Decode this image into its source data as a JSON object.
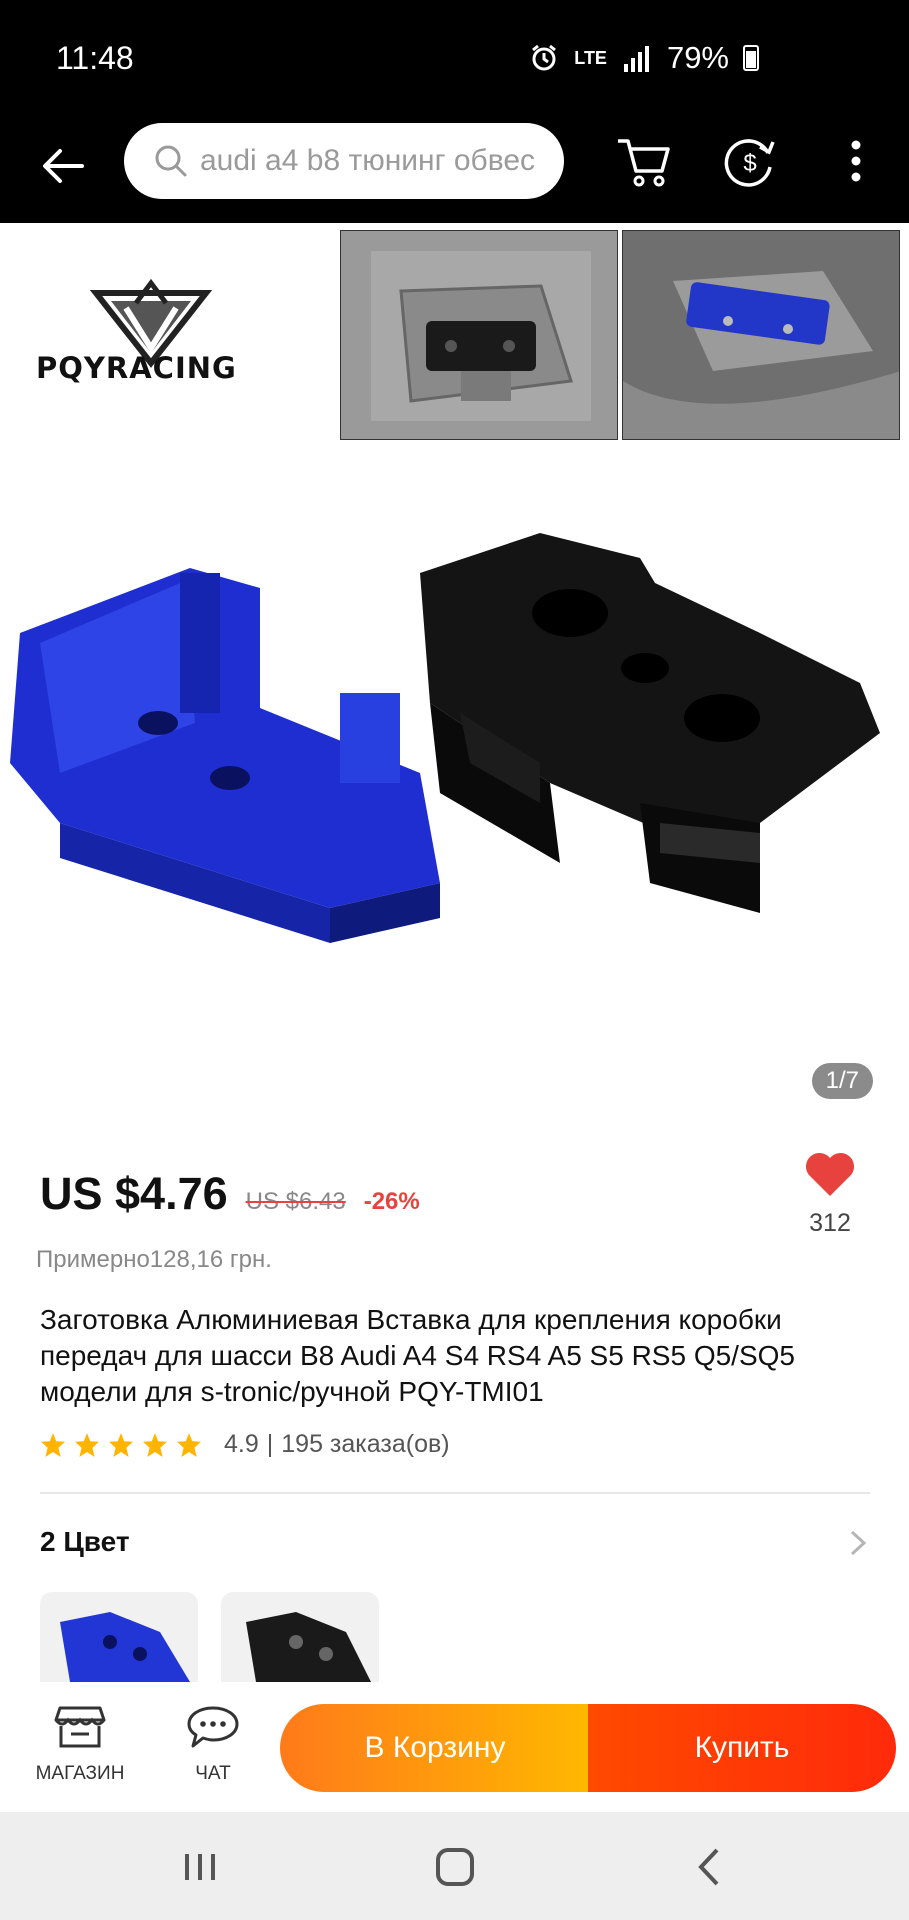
{
  "status_bar": {
    "time": "11:48",
    "network": "LTE",
    "battery": "79%"
  },
  "search": {
    "placeholder": "audi a4 b8 тюнинг обвес"
  },
  "gallery": {
    "brand_name": "PQYRACING",
    "counter": "1/7"
  },
  "product": {
    "price": "US $4.76",
    "old_price": "US $6.43",
    "discount": "-26%",
    "wishlist_count": "312",
    "approx_price": "Примерно128,16 грн.",
    "title": "Заготовка Алюминиевая Вставка для крепления коробки передач для шасси B8 Audi A4 S4 RS4 A5 S5 RS5 Q5/SQ5 модели для s-tronic/ручной PQY-TMI01",
    "rating": "4.9",
    "orders": "195 заказа(ов)",
    "stars": 5
  },
  "colors": {
    "title": "2 Цвет",
    "options": [
      "blue",
      "black"
    ]
  },
  "action_bar": {
    "store_label": "МАГАЗИН",
    "chat_label": "ЧАТ",
    "cart_label": "В Корзину",
    "buy_label": "Купить"
  },
  "theme": {
    "accent_red": "#e8423e",
    "star_color": "#ffb400",
    "cart_gradient": [
      "#ff7a1a",
      "#ffb800"
    ],
    "buy_gradient": [
      "#ff4a00",
      "#ff2a0a"
    ]
  }
}
